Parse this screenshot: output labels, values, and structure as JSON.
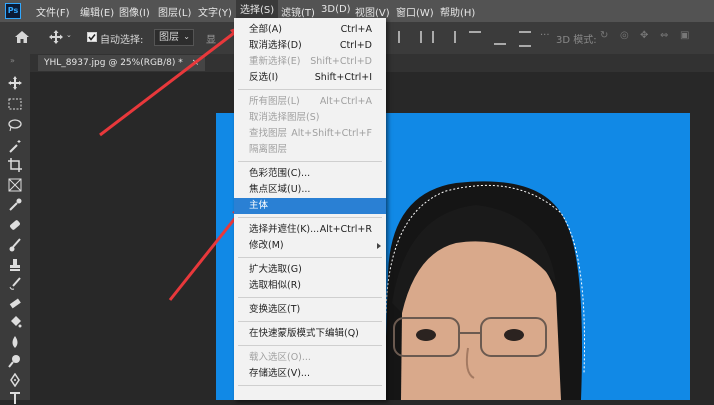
{
  "app": {
    "logo": "Ps"
  },
  "menubar": {
    "items": [
      "文件(F)",
      "编辑(E)",
      "图像(I)",
      "图层(L)",
      "文字(Y)",
      "选择(S)",
      "滤镜(T)",
      "3D(D)",
      "视图(V)",
      "窗口(W)",
      "帮助(H)"
    ],
    "active": "选择(S)"
  },
  "options": {
    "auto_select_label": "自动选择:",
    "auto_select_checked": true,
    "layer_value": "图层",
    "show_label": "显",
    "mode_3d_label": "3D 模式:"
  },
  "document": {
    "tab_title": "YHL_8937.jpg @ 25%(RGB/8) *",
    "close_symbol": "×"
  },
  "select_menu": {
    "items": [
      {
        "label": "全部(A)",
        "shortcut": "Ctrl+A",
        "disabled": false
      },
      {
        "label": "取消选择(D)",
        "shortcut": "Ctrl+D",
        "disabled": false
      },
      {
        "label": "重新选择(E)",
        "shortcut": "Shift+Ctrl+D",
        "disabled": true
      },
      {
        "label": "反选(I)",
        "shortcut": "Shift+Ctrl+I",
        "disabled": false
      },
      {
        "label": "所有图层(L)",
        "shortcut": "Alt+Ctrl+A",
        "disabled": true
      },
      {
        "label": "取消选择图层(S)",
        "shortcut": "",
        "disabled": true
      },
      {
        "label": "查找图层",
        "shortcut": "Alt+Shift+Ctrl+F",
        "disabled": true
      },
      {
        "label": "隔离图层",
        "shortcut": "",
        "disabled": true
      },
      {
        "label": "色彩范围(C)...",
        "shortcut": "",
        "disabled": false
      },
      {
        "label": "焦点区域(U)...",
        "shortcut": "",
        "disabled": false
      },
      {
        "label": "主体",
        "shortcut": "",
        "disabled": false,
        "highlighted": true
      },
      {
        "label": "选择并遮住(K)...",
        "shortcut": "Alt+Ctrl+R",
        "disabled": false
      },
      {
        "label": "修改(M)",
        "shortcut": "",
        "disabled": false,
        "submenu": true
      },
      {
        "label": "扩大选取(G)",
        "shortcut": "",
        "disabled": false
      },
      {
        "label": "选取相似(R)",
        "shortcut": "",
        "disabled": false
      },
      {
        "label": "变换选区(T)",
        "shortcut": "",
        "disabled": false
      },
      {
        "label": "在快速蒙版模式下编辑(Q)",
        "shortcut": "",
        "disabled": false
      },
      {
        "label": "载入选区(O)...",
        "shortcut": "",
        "disabled": true
      },
      {
        "label": "存储选区(V)...",
        "shortcut": "",
        "disabled": false
      }
    ]
  },
  "colors": {
    "menubar": "#535353",
    "highlight": "#2a80d4",
    "photo_bg": "#1189e6",
    "arrow": "#e8383b"
  }
}
